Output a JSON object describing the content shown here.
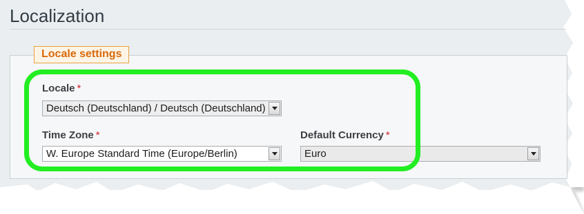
{
  "page": {
    "title": "Localization"
  },
  "fieldset": {
    "legend": "Locale settings"
  },
  "fields": {
    "locale": {
      "label": "Locale",
      "required_mark": "*",
      "value": "Deutsch (Deutschland) / Deutsch (Deutschland)"
    },
    "time_zone": {
      "label": "Time Zone",
      "required_mark": "*",
      "value": "W. Europe Standard Time (Europe/Berlin)"
    },
    "default_currency": {
      "label": "Default Currency",
      "required_mark": "*",
      "value": "Euro"
    }
  },
  "colors": {
    "legend_text": "#d86a0b",
    "legend_border": "#e8a13c",
    "required": "#d0232a",
    "highlight": "#22ee22"
  },
  "icons": {
    "dropdown": "chevron-down-icon"
  }
}
